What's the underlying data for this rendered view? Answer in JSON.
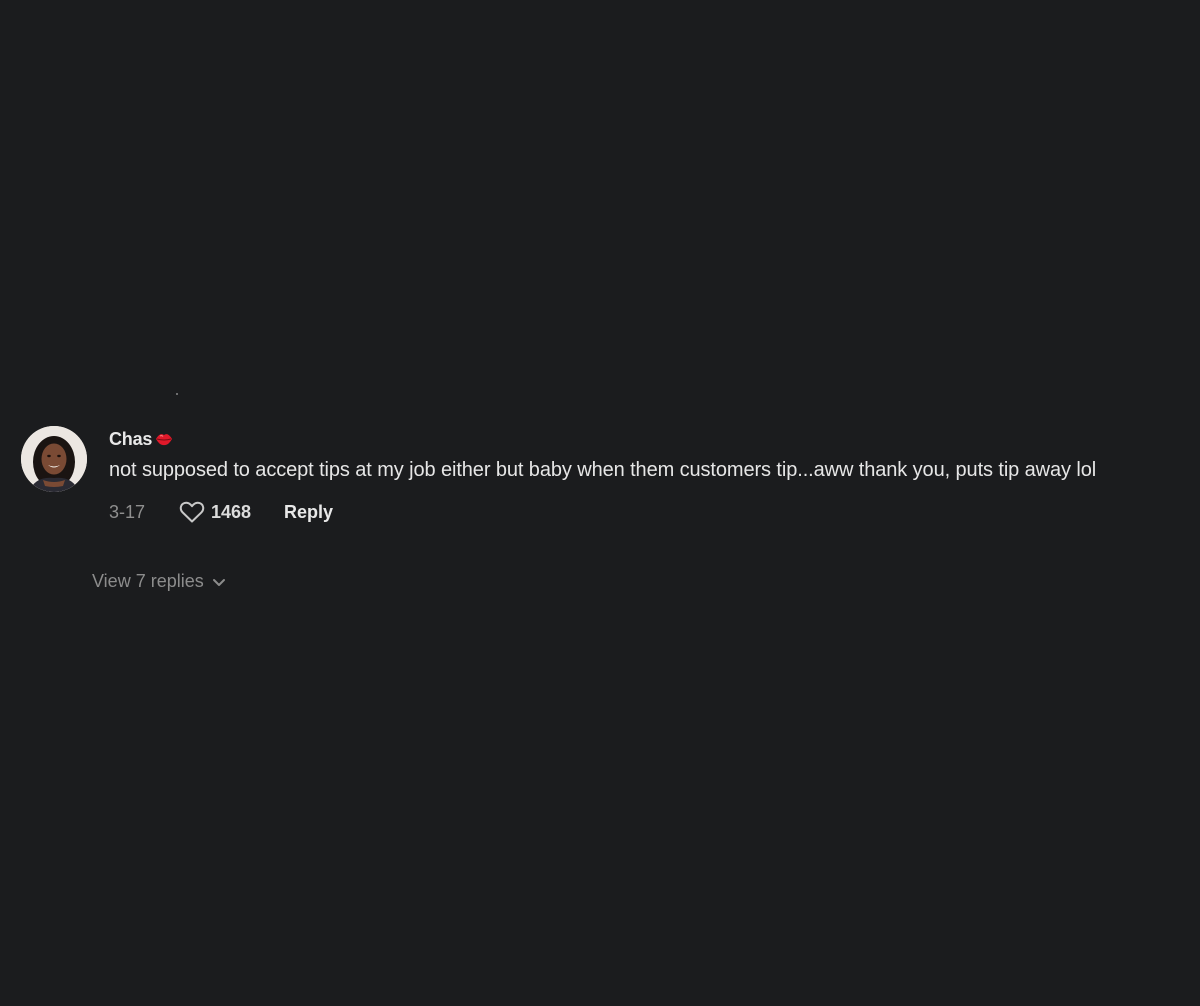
{
  "comment": {
    "username": "Chas",
    "username_emoji": "lips-kiss-icon",
    "text": "not supposed to accept tips at my job either but baby when them customers tip...aww thank you, puts tip away lol",
    "date": "3-17",
    "like_count": "1468",
    "reply_label": "Reply",
    "view_replies_label": "View 7 replies"
  },
  "colors": {
    "background": "#1b1c1e",
    "primary_text": "#e6e6e6",
    "secondary_text": "#8f8f8f",
    "emoji_red": "#e0192a"
  },
  "icons": {
    "like": "heart-outline-icon",
    "expand": "chevron-down-icon",
    "avatar": "profile-photo-avatar"
  }
}
